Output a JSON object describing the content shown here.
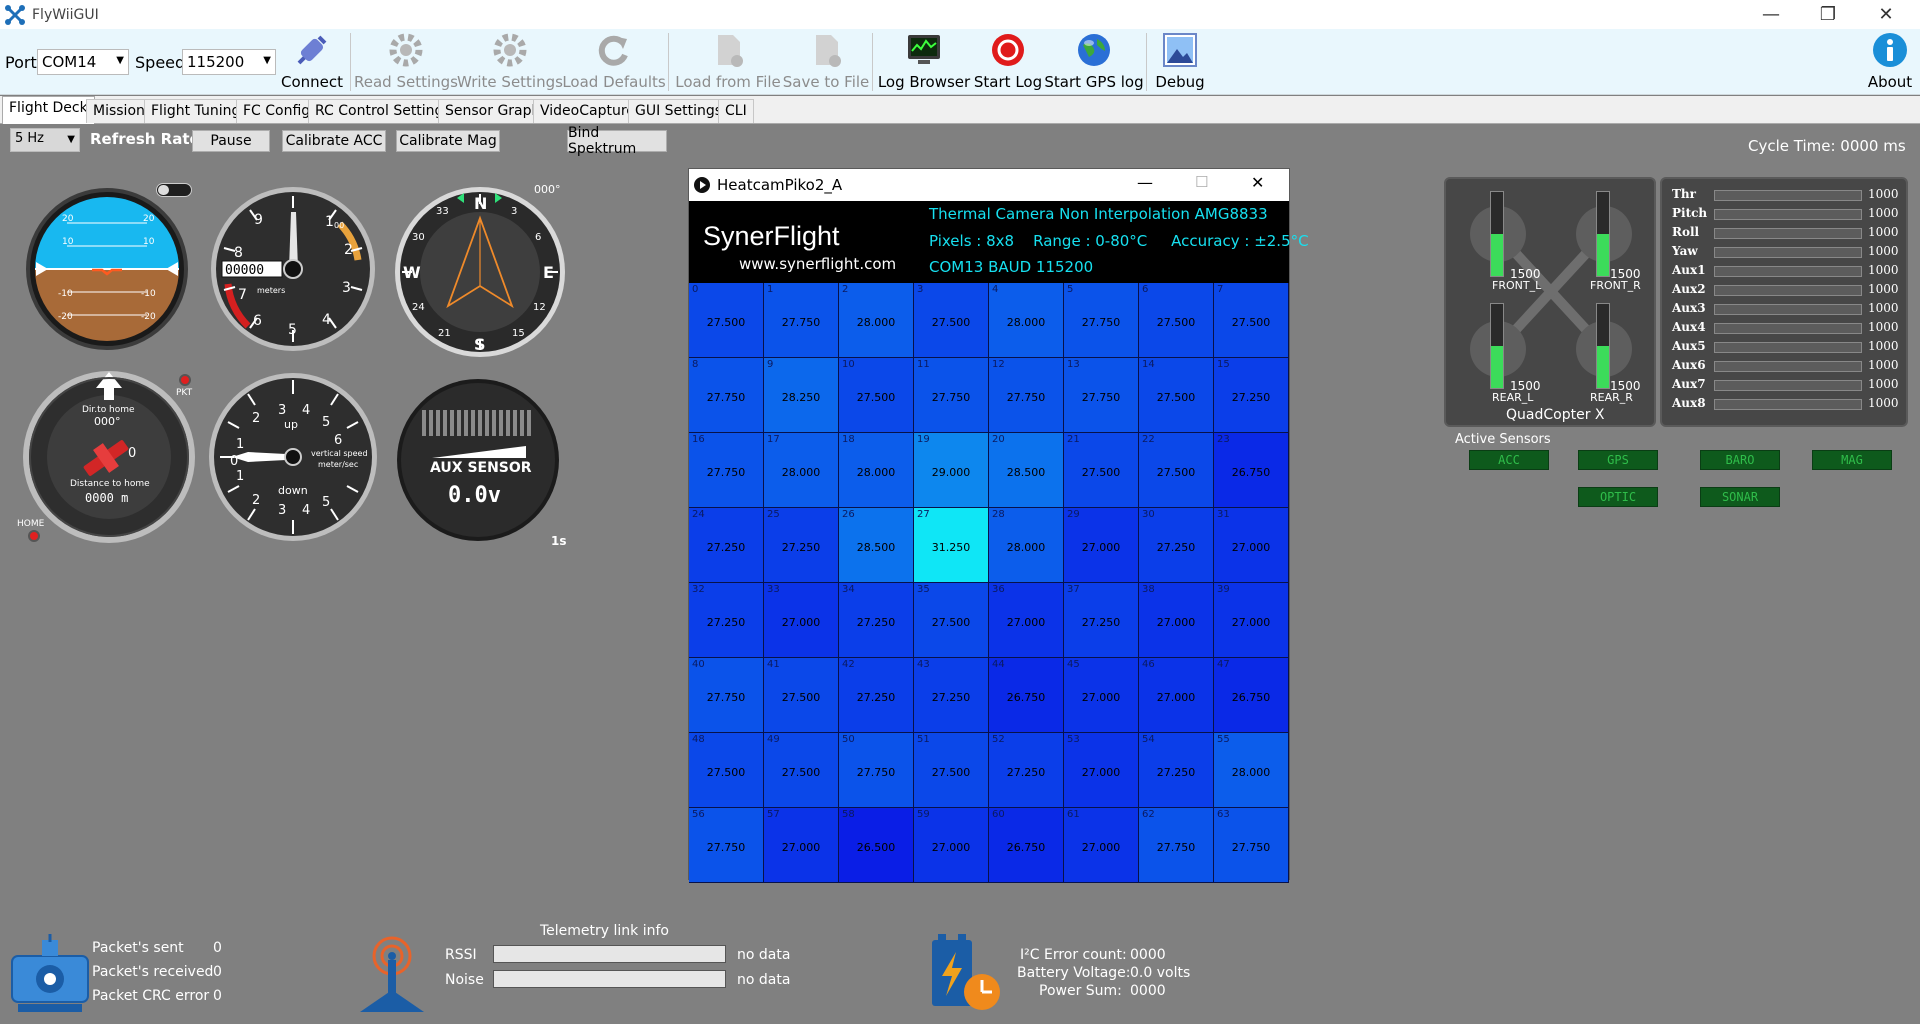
{
  "app": {
    "title": "FlyWiiGUI"
  },
  "toolbar": {
    "port_label": "Port",
    "port_value": "COM14",
    "speed_label": "Speed",
    "speed_value": "115200",
    "buttons": {
      "connect": "Connect",
      "read_settings": "Read Settings",
      "write_settings": "Write Settings",
      "load_defaults": "Load Defaults",
      "load_from_file": "Load from File",
      "save_to_file": "Save to File",
      "log_browser": "Log Browser",
      "start_log": "Start Log",
      "start_gps_log": "Start GPS log",
      "debug": "Debug",
      "about": "About"
    }
  },
  "tabs": [
    "Flight Deck",
    "Mission",
    "Flight Tuning",
    "FC Config",
    "RC Control Settings",
    "Sensor Graph",
    "VideoCapture",
    "GUI Settings",
    "CLI"
  ],
  "controls": {
    "rate_value": "5 Hz",
    "refresh_rate_label": "Refresh Rate",
    "pause": "Pause",
    "calibrate_acc": "Calibrate ACC",
    "calibrate_mag": "Calibrate Mag",
    "bind_spektrum": "Bind Spektrum",
    "cycle_time": "Cycle Time:  0000 ms"
  },
  "instruments": {
    "attitude_ticks": [
      "20",
      "20",
      "10",
      "10",
      "-10",
      "-10",
      "-20",
      "-20"
    ],
    "altimeter": {
      "digits": "00000",
      "unit": "meters",
      "hundreds": "1",
      "sub": "00",
      "n1": "9",
      "n2": "8",
      "n3": "7",
      "n4": "6",
      "n5": "5",
      "n6": "4",
      "n7": "3",
      "n8": "2"
    },
    "heading": {
      "deg": "000°",
      "n": "N",
      "e": "E",
      "s": "S",
      "w": "W",
      "t3": "3",
      "t6": "6",
      "t12": "12",
      "t15": "15",
      "t21": "21",
      "t24": "24",
      "t30": "30",
      "t33": "33"
    },
    "home": {
      "dir_label": "Dir.to home",
      "dir_value": "000°",
      "dist_label": "Distance to home",
      "dist_value": "0000  m",
      "zero": "0",
      "pkt": "PKT",
      "home": "HOME"
    },
    "vario": {
      "up": "up",
      "down": "down",
      "unit_line1": "vertical speed",
      "unit_line2": "meter/sec",
      "n1": "1",
      "n2": "2",
      "n3": "3",
      "n4": "4",
      "n5": "5",
      "n6": "6",
      "n0": "0"
    },
    "aux": {
      "label": "AUX SENSOR",
      "value": "0.0v",
      "time": "1s"
    }
  },
  "heatcam": {
    "window_title": "HeatcamPiko2_A",
    "brand": "SynerFlight",
    "url": "www.synerflight.com",
    "line1": "Thermal Camera Non Interpolation AMG8833",
    "line2": "Pixels : 8x8    Range : 0-80°C     Accuracy : ±2.5°C",
    "line3": "COM13 BAUD 115200",
    "cells": [
      {
        "i": "0",
        "v": "27.500"
      },
      {
        "i": "1",
        "v": "27.750"
      },
      {
        "i": "2",
        "v": "28.000"
      },
      {
        "i": "3",
        "v": "27.500"
      },
      {
        "i": "4",
        "v": "28.000"
      },
      {
        "i": "5",
        "v": "27.750"
      },
      {
        "i": "6",
        "v": "27.500"
      },
      {
        "i": "7",
        "v": "27.500"
      },
      {
        "i": "8",
        "v": "27.750"
      },
      {
        "i": "9",
        "v": "28.250"
      },
      {
        "i": "10",
        "v": "27.500"
      },
      {
        "i": "11",
        "v": "27.750"
      },
      {
        "i": "12",
        "v": "27.750"
      },
      {
        "i": "13",
        "v": "27.750"
      },
      {
        "i": "14",
        "v": "27.500"
      },
      {
        "i": "15",
        "v": "27.250"
      },
      {
        "i": "16",
        "v": "27.750"
      },
      {
        "i": "17",
        "v": "28.000"
      },
      {
        "i": "18",
        "v": "28.000"
      },
      {
        "i": "19",
        "v": "29.000"
      },
      {
        "i": "20",
        "v": "28.500"
      },
      {
        "i": "21",
        "v": "27.500"
      },
      {
        "i": "22",
        "v": "27.500"
      },
      {
        "i": "23",
        "v": "26.750"
      },
      {
        "i": "24",
        "v": "27.250"
      },
      {
        "i": "25",
        "v": "27.250"
      },
      {
        "i": "26",
        "v": "28.500"
      },
      {
        "i": "27",
        "v": "31.250"
      },
      {
        "i": "28",
        "v": "28.000"
      },
      {
        "i": "29",
        "v": "27.000"
      },
      {
        "i": "30",
        "v": "27.250"
      },
      {
        "i": "31",
        "v": "27.000"
      },
      {
        "i": "32",
        "v": "27.250"
      },
      {
        "i": "33",
        "v": "27.000"
      },
      {
        "i": "34",
        "v": "27.250"
      },
      {
        "i": "35",
        "v": "27.500"
      },
      {
        "i": "36",
        "v": "27.000"
      },
      {
        "i": "37",
        "v": "27.250"
      },
      {
        "i": "38",
        "v": "27.000"
      },
      {
        "i": "39",
        "v": "27.000"
      },
      {
        "i": "40",
        "v": "27.750"
      },
      {
        "i": "41",
        "v": "27.500"
      },
      {
        "i": "42",
        "v": "27.250"
      },
      {
        "i": "43",
        "v": "27.250"
      },
      {
        "i": "44",
        "v": "26.750"
      },
      {
        "i": "45",
        "v": "27.000"
      },
      {
        "i": "46",
        "v": "27.000"
      },
      {
        "i": "47",
        "v": "26.750"
      },
      {
        "i": "48",
        "v": "27.500"
      },
      {
        "i": "49",
        "v": "27.500"
      },
      {
        "i": "50",
        "v": "27.750"
      },
      {
        "i": "51",
        "v": "27.500"
      },
      {
        "i": "52",
        "v": "27.250"
      },
      {
        "i": "53",
        "v": "27.000"
      },
      {
        "i": "54",
        "v": "27.250"
      },
      {
        "i": "55",
        "v": "28.000"
      },
      {
        "i": "56",
        "v": "27.750"
      },
      {
        "i": "57",
        "v": "27.000"
      },
      {
        "i": "58",
        "v": "26.500"
      },
      {
        "i": "59",
        "v": "27.000"
      },
      {
        "i": "60",
        "v": "26.750"
      },
      {
        "i": "61",
        "v": "27.000"
      },
      {
        "i": "62",
        "v": "27.750"
      },
      {
        "i": "63",
        "v": "27.750"
      }
    ]
  },
  "motors": {
    "front_l": {
      "label": "FRONT_L",
      "value": "1500",
      "level": 0.5
    },
    "front_r": {
      "label": "FRONT_R",
      "value": "1500",
      "level": 0.5
    },
    "rear_l": {
      "label": "REAR_L",
      "value": "1500",
      "level": 0.5
    },
    "rear_r": {
      "label": "REAR_R",
      "value": "1500",
      "level": 0.5
    },
    "frame": "QuadCopter X"
  },
  "channels": [
    {
      "name": "Thr",
      "value": "1000"
    },
    {
      "name": "Pitch",
      "value": "1000"
    },
    {
      "name": "Roll",
      "value": "1000"
    },
    {
      "name": "Yaw",
      "value": "1000"
    },
    {
      "name": "Aux1",
      "value": "1000"
    },
    {
      "name": "Aux2",
      "value": "1000"
    },
    {
      "name": "Aux3",
      "value": "1000"
    },
    {
      "name": "Aux4",
      "value": "1000"
    },
    {
      "name": "Aux5",
      "value": "1000"
    },
    {
      "name": "Aux6",
      "value": "1000"
    },
    {
      "name": "Aux7",
      "value": "1000"
    },
    {
      "name": "Aux8",
      "value": "1000"
    }
  ],
  "active_sensors": {
    "title": "Active Sensors",
    "acc": "ACC",
    "gps": "GPS",
    "baro": "BARO",
    "mag": "MAG",
    "optic": "OPTIC",
    "sonar": "SONAR"
  },
  "packets": {
    "sent_label": "Packet's sent",
    "sent_value": "0",
    "received_label": "Packet's received",
    "received_value": "0",
    "crc_label": "Packet CRC error",
    "crc_value": "0"
  },
  "telemetry": {
    "title": "Telemetry link info",
    "rssi_label": "RSSI",
    "rssi_value": "no data",
    "noise_label": "Noise",
    "noise_value": "no data"
  },
  "power": {
    "i2c_label": "I²C Error count:",
    "i2c_value": "0000",
    "battery_label": "Battery Voltage:",
    "battery_value": "0.0 volts",
    "power_label": "Power Sum:",
    "power_value": "0000"
  },
  "colors": {
    "accent": "#1a8fd8",
    "heat_hot": "#0fd6f6",
    "heat_cold": "#0a1ee6"
  }
}
